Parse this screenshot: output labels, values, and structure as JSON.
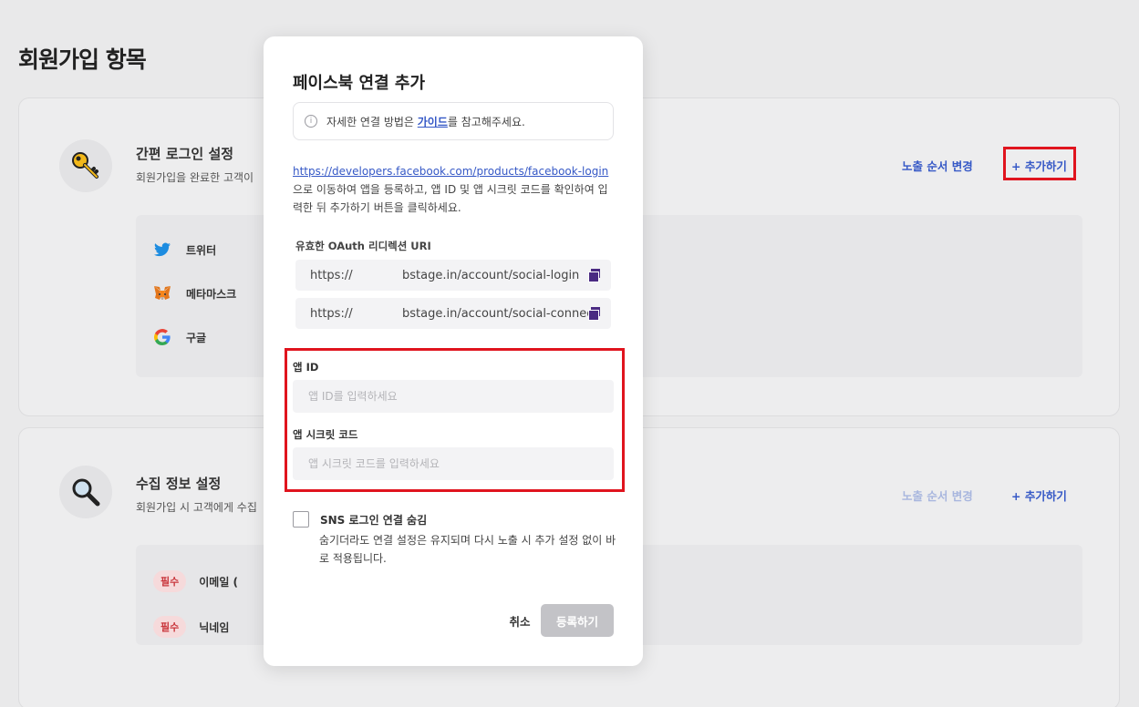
{
  "page": {
    "title": "회원가입 항목"
  },
  "login_card": {
    "title": "간편 로그인 설정",
    "desc": "회원가입을 완료한 고객이",
    "order_label": "노출 순서 변경",
    "add_label": "+ 추가하기",
    "icon": "key-icon",
    "social": [
      {
        "label": "트위터",
        "icon": "twitter-icon"
      },
      {
        "label": "메타마스크",
        "icon": "metamask-icon"
      },
      {
        "label": "구글",
        "icon": "google-icon"
      }
    ]
  },
  "collect_card": {
    "title": "수집 정보 설정",
    "desc": "회원가입 시 고객에게 수집",
    "order_label": "노출 순서 변경",
    "add_label": "+ 추가하기",
    "icon": "magnifier-icon",
    "rows": [
      {
        "badge": "필수",
        "label": "이메일 ("
      },
      {
        "badge": "필수",
        "label": "닉네임"
      }
    ]
  },
  "modal": {
    "title": "페이스북 연결 추가",
    "info_prefix": "자세한 연결 방법은 ",
    "info_link": "가이드",
    "info_suffix": "를 참고해주세요.",
    "url": "https://developers.facebook.com/products/facebook-login",
    "instructions": " 으로 이동하여 앱을 등록하고, 앱 ID 및 앱 시크릿 코드를 확인하여 입력한 뒤 추가하기 버튼을 클릭하세요.",
    "uri_label": "유효한 OAuth 리디렉션 URI",
    "uris": [
      {
        "proto": "https://",
        "path": "bstage.in/account/social-login"
      },
      {
        "proto": "https://",
        "path": "bstage.in/account/social-connect"
      }
    ],
    "app_id_label": "앱 ID",
    "app_id_placeholder": "앱 ID를 입력하세요",
    "app_id_value": "",
    "secret_label": "앱 시크릿 코드",
    "secret_placeholder": "앱 시크릿 코드를 입력하세요",
    "secret_value": "",
    "hide_label": "SNS 로그인 연결 숨김",
    "hide_checked": false,
    "hide_desc": "숨기더라도 연결 설정은 유지되며 다시 노출 시 추가 설정 없이 바로 적용됩니다.",
    "cancel_label": "취소",
    "submit_label": "등록하기"
  },
  "colors": {
    "accent": "#3558c6",
    "highlight": "#e0141e",
    "disabled_button": "#c3c3c7",
    "required_badge": "#c9363c"
  }
}
